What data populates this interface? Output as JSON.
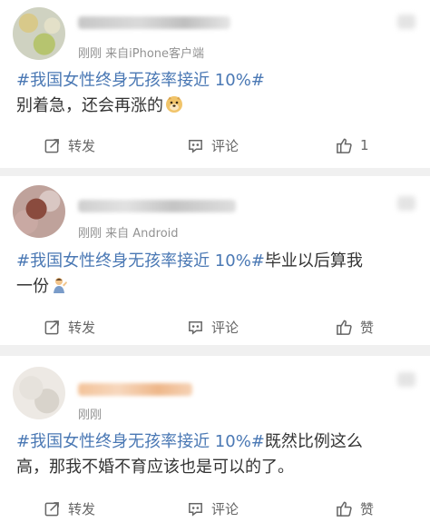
{
  "posts": [
    {
      "meta": "刚刚  来自iPhone客户端",
      "hashtag": "#我国女性终身无孩率接近 10%#",
      "line1_rest": "",
      "line2": "别着急，还会再涨的",
      "emoji": "doge-emoji",
      "actions": {
        "repost": "转发",
        "comment": "评论",
        "like": "1"
      }
    },
    {
      "meta": "刚刚  来自 Android",
      "hashtag": "#我国女性终身无孩率接近 10%#",
      "line1_rest": "毕业以后算我",
      "line2": "一份",
      "emoji": "person-emoji",
      "actions": {
        "repost": "转发",
        "comment": "评论",
        "like": "赞"
      }
    },
    {
      "meta": "刚刚",
      "hashtag": "#我国女性终身无孩率接近 10%#",
      "line1_rest": "既然比例这么",
      "line2": "高，那我不婚不育应该也是可以的了。",
      "emoji": "",
      "actions": {
        "repost": "转发",
        "comment": "评论",
        "like": "赞"
      }
    }
  ],
  "colors": {
    "hashtag": "#4a78b4",
    "meta": "#939393",
    "divider": "#f0f0f0"
  }
}
